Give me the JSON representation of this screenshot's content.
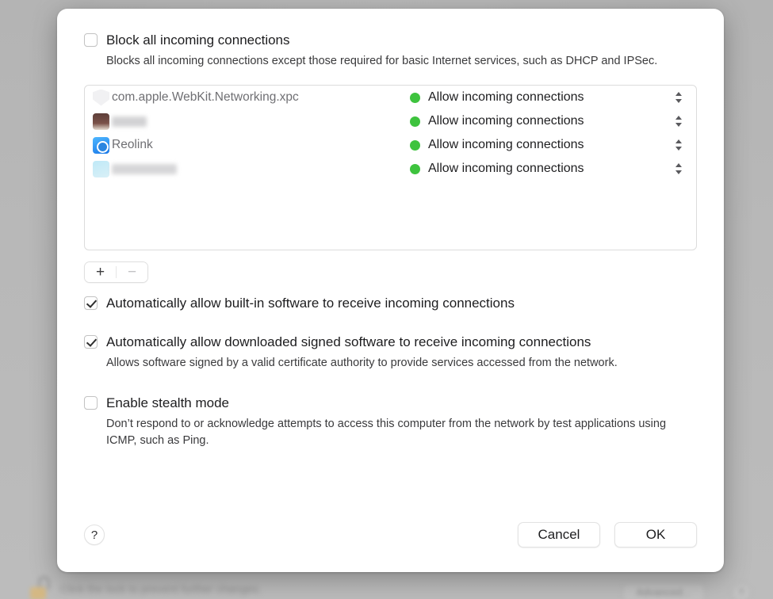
{
  "background": {
    "lock_icon": "unlocked-padlock-icon",
    "hint_text": "Click the lock to prevent further changes.",
    "advanced_label": "Advanced...",
    "help_label": "?"
  },
  "dialog": {
    "block_all": {
      "label": "Block all incoming connections",
      "checked": false,
      "description": "Blocks all incoming connections except those required for basic Internet services, such as DHCP and IPSec."
    },
    "apps": [
      {
        "name": "com.apple.WebKit.Networking.xpc",
        "redacted": false,
        "icon": "shield-icon",
        "status": "Allow incoming connections",
        "status_color": "#3ec33e"
      },
      {
        "name": "",
        "redacted": true,
        "redacted_width": 44,
        "icon": "brown-app-icon",
        "status": "Allow incoming connections",
        "status_color": "#3ec33e"
      },
      {
        "name": "Reolink",
        "redacted": false,
        "icon": "reolink-icon",
        "status": "Allow incoming connections",
        "status_color": "#3ec33e"
      },
      {
        "name": "",
        "redacted": true,
        "redacted_width": 82,
        "icon": "cyan-app-icon",
        "status": "Allow incoming connections",
        "status_color": "#3ec33e"
      }
    ],
    "list_controls": {
      "add_label": "+",
      "remove_label": "−"
    },
    "allow_builtin": {
      "label": "Automatically allow built-in software to receive incoming connections",
      "checked": true
    },
    "allow_signed": {
      "label": "Automatically allow downloaded signed software to receive incoming connections",
      "checked": true,
      "description": "Allows software signed by a valid certificate authority to provide services accessed from the network."
    },
    "stealth_mode": {
      "label": "Enable stealth mode",
      "checked": false,
      "description": "Don’t respond to or acknowledge attempts to access this computer from the network by test applications using ICMP, such as Ping."
    },
    "footer": {
      "help_label": "?",
      "cancel_label": "Cancel",
      "ok_label": "OK"
    }
  }
}
